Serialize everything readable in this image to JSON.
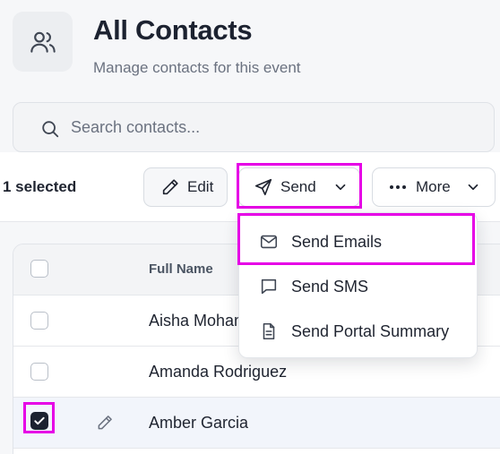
{
  "header": {
    "title": "All Contacts",
    "subtitle": "Manage contacts for this event",
    "icon": "users-icon"
  },
  "search": {
    "placeholder": "Search contacts...",
    "value": ""
  },
  "toolbar": {
    "selected_label": "1 selected",
    "edit_label": "Edit",
    "send_label": "Send",
    "more_label": "More"
  },
  "send_menu": {
    "items": [
      {
        "label": "Send Emails",
        "icon": "mail-icon"
      },
      {
        "label": "Send SMS",
        "icon": "message-icon"
      },
      {
        "label": "Send Portal Summary",
        "icon": "document-icon"
      }
    ]
  },
  "table": {
    "columns": [
      "Full Name"
    ],
    "rows": [
      {
        "name": "Aisha Mohamed",
        "checked": false
      },
      {
        "name": "Amanda Rodriguez",
        "checked": false
      },
      {
        "name": "Amber Garcia",
        "checked": true
      }
    ]
  },
  "colors": {
    "highlight": "#e600e6",
    "text": "#1f2430",
    "muted": "#6b7280"
  }
}
